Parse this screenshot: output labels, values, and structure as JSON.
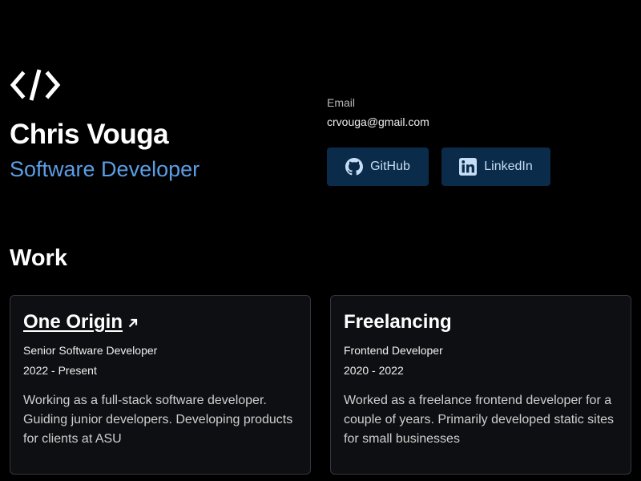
{
  "colors": {
    "background": "#000000",
    "accent": "#5a9ee6",
    "button_bg": "#0b2b4a",
    "button_text": "#c6ddf5",
    "card_bg": "#0e0f12",
    "card_border": "#33363b"
  },
  "header": {
    "logo_icon": "code-icon",
    "name": "Chris Vouga",
    "role": "Software Developer"
  },
  "contact": {
    "email_label": "Email",
    "email": "crvouga@gmail.com",
    "buttons": [
      {
        "label": "GitHub",
        "icon": "github-icon"
      },
      {
        "label": "LinkedIn",
        "icon": "linkedin-icon"
      }
    ]
  },
  "work": {
    "title": "Work",
    "items": [
      {
        "company": "One Origin",
        "link_icon": "arrow-up-right-icon",
        "role": "Senior Software Developer",
        "dates": "2022 - Present",
        "description": "Working as a full-stack software developer. Guiding junior developers. Developing products for clients at ASU"
      },
      {
        "company": "Freelancing",
        "role": "Frontend Developer",
        "dates": "2020 - 2022",
        "description": "Worked as a freelance frontend developer for a couple of years. Primarily developed static sites for small businesses"
      }
    ]
  }
}
